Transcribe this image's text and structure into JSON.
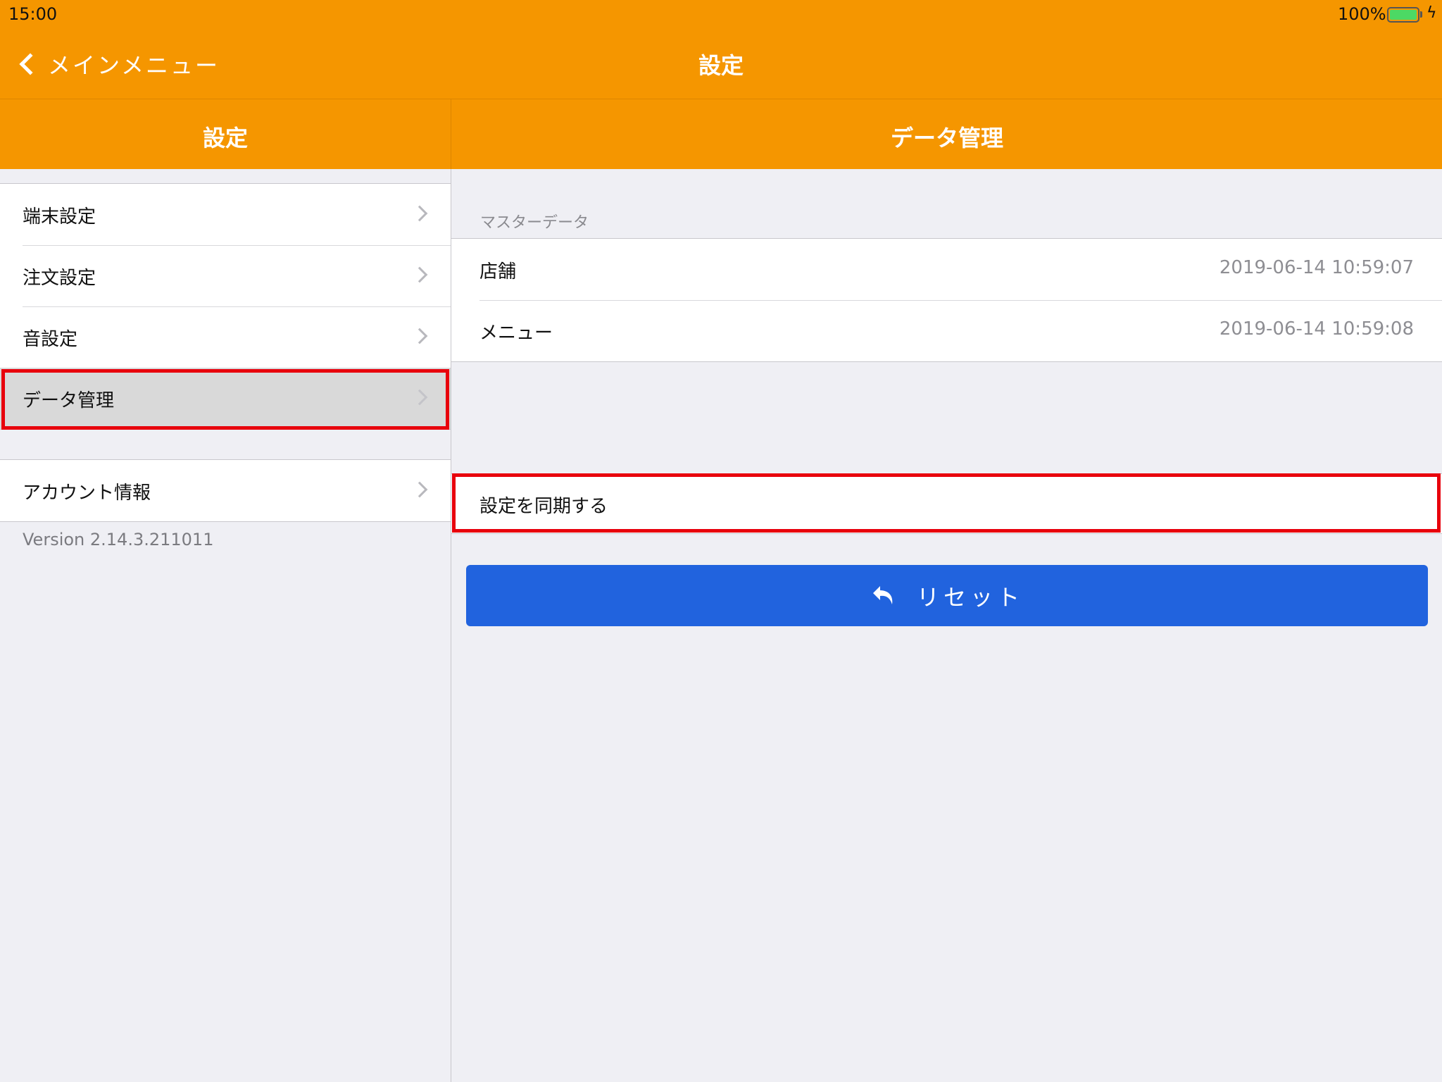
{
  "status_bar": {
    "time": "15:00",
    "battery_percent": "100%"
  },
  "nav": {
    "back_label": "メインメニュー",
    "title": "設定"
  },
  "left_panel": {
    "title": "設定",
    "items": [
      {
        "label": "端末設定"
      },
      {
        "label": "注文設定"
      },
      {
        "label": "音設定"
      },
      {
        "label": "データ管理",
        "selected": true
      }
    ],
    "account_item": {
      "label": "アカウント情報"
    },
    "version": "Version 2.14.3.211011"
  },
  "right_panel": {
    "title": "データ管理",
    "master_data": {
      "header": "マスターデータ",
      "rows": [
        {
          "label": "店舗",
          "value": "2019-06-14 10:59:07"
        },
        {
          "label": "メニュー",
          "value": "2019-06-14 10:59:08"
        }
      ]
    },
    "sync_label": "設定を同期する",
    "reset_label": "リセット"
  },
  "colors": {
    "header_orange": "#f59600",
    "reset_blue": "#2163de",
    "highlight_red": "#e8000c",
    "battery_green": "#4cd964"
  },
  "icons": {
    "back": "chevron-left-icon",
    "row_disclosure": "chevron-right-icon",
    "reset": "undo-icon",
    "battery": "battery-icon",
    "charging": "bolt-icon"
  }
}
